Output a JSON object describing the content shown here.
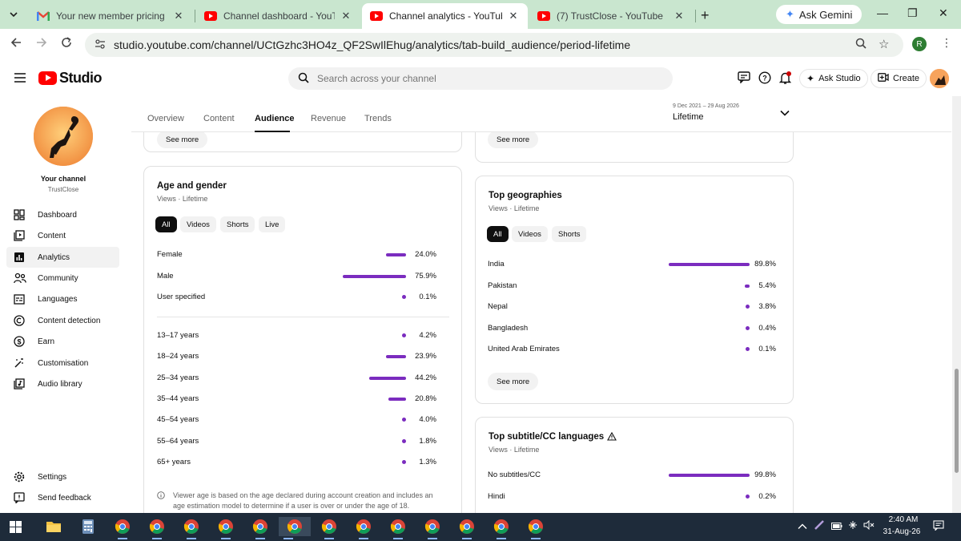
{
  "browser": {
    "tabs": [
      {
        "title": "Your new member pricing is no",
        "icon": "gmail-icon",
        "active": false
      },
      {
        "title": "Channel dashboard - YouTube",
        "icon": "youtube-icon",
        "active": false
      },
      {
        "title": "Channel analytics - YouTube St",
        "icon": "youtube-icon",
        "active": true
      },
      {
        "title": "(7) TrustClose - YouTube",
        "icon": "youtube-icon",
        "active": false
      }
    ],
    "new_tab": "+",
    "ask_gemini": "Ask Gemini",
    "url": "studio.youtube.com/channel/UCtGzhc3HO4z_QF2SwIlEhug/analytics/tab-build_audience/period-lifetime",
    "profile_initial": "R"
  },
  "header": {
    "logo_text": "Studio",
    "search_placeholder": "Search across your channel",
    "ask_studio": "Ask Studio",
    "create": "Create"
  },
  "sidebar": {
    "channel_title": "Your channel",
    "channel_name": "TrustClose",
    "items": [
      {
        "label": "Dashboard",
        "icon": "dashboard-icon"
      },
      {
        "label": "Content",
        "icon": "content-icon"
      },
      {
        "label": "Analytics",
        "icon": "analytics-icon"
      },
      {
        "label": "Community",
        "icon": "community-icon"
      },
      {
        "label": "Languages",
        "icon": "languages-icon"
      },
      {
        "label": "Content detection",
        "icon": "copyright-icon"
      },
      {
        "label": "Earn",
        "icon": "dollar-icon"
      },
      {
        "label": "Customisation",
        "icon": "magic-wand-icon"
      },
      {
        "label": "Audio library",
        "icon": "audio-library-icon"
      }
    ],
    "bottom_items": [
      {
        "label": "Settings",
        "icon": "gear-icon"
      },
      {
        "label": "Send feedback",
        "icon": "feedback-icon"
      }
    ]
  },
  "subnav": {
    "tabs": [
      "Overview",
      "Content",
      "Audience",
      "Revenue",
      "Trends"
    ],
    "active_tab": "Audience",
    "period_range": "9 Dec 2021 – 29 Aug 2026",
    "period_value": "Lifetime"
  },
  "top_cards": {
    "left_see_more": "See more",
    "right_see_more": "See more"
  },
  "age_gender": {
    "title": "Age and gender",
    "subtitle": "Views · Lifetime",
    "filters": [
      "All",
      "Videos",
      "Shorts",
      "Live"
    ],
    "selected_filter": "All",
    "gender_rows": [
      {
        "label": "Female",
        "value": "24.0%",
        "fraction": 0.24
      },
      {
        "label": "Male",
        "value": "75.9%",
        "fraction": 0.759
      },
      {
        "label": "User specified",
        "value": "0.1%",
        "fraction": 0.001
      }
    ],
    "age_rows": [
      {
        "label": "13–17 years",
        "value": "4.2%",
        "fraction": 0.042
      },
      {
        "label": "18–24 years",
        "value": "23.9%",
        "fraction": 0.239
      },
      {
        "label": "25–34 years",
        "value": "44.2%",
        "fraction": 0.442
      },
      {
        "label": "35–44 years",
        "value": "20.8%",
        "fraction": 0.208
      },
      {
        "label": "45–54 years",
        "value": "4.0%",
        "fraction": 0.04
      },
      {
        "label": "55–64 years",
        "value": "1.8%",
        "fraction": 0.018
      },
      {
        "label": "65+ years",
        "value": "1.3%",
        "fraction": 0.013
      }
    ],
    "note": "Viewer age is based on the age declared during account creation and includes an age estimation model to determine if a user is over or under the age of 18."
  },
  "geographies": {
    "title": "Top geographies",
    "subtitle": "Views · Lifetime",
    "filters": [
      "All",
      "Videos",
      "Shorts"
    ],
    "selected_filter": "All",
    "rows": [
      {
        "label": "India",
        "value": "89.8%",
        "fraction": 0.898
      },
      {
        "label": "Pakistan",
        "value": "5.4%",
        "fraction": 0.054
      },
      {
        "label": "Nepal",
        "value": "3.8%",
        "fraction": 0.038
      },
      {
        "label": "Bangladesh",
        "value": "0.4%",
        "fraction": 0.004
      },
      {
        "label": "United Arab Emirates",
        "value": "0.1%",
        "fraction": 0.001
      }
    ],
    "see_more": "See more"
  },
  "subtitles": {
    "title": "Top subtitle/CC languages",
    "subtitle": "Views · Lifetime",
    "rows": [
      {
        "label": "No subtitles/CC",
        "value": "99.8%",
        "fraction": 0.998
      },
      {
        "label": "Hindi",
        "value": "0.2%",
        "fraction": 0.002
      }
    ]
  },
  "taskbar": {
    "time": "2:40 AM",
    "date": "31-Aug-26"
  },
  "colors": {
    "bar": "#7b2cbf",
    "tabstrip": "#c9e6cf",
    "youtube_red": "#ff0000",
    "taskbar": "#1e2b3a"
  }
}
